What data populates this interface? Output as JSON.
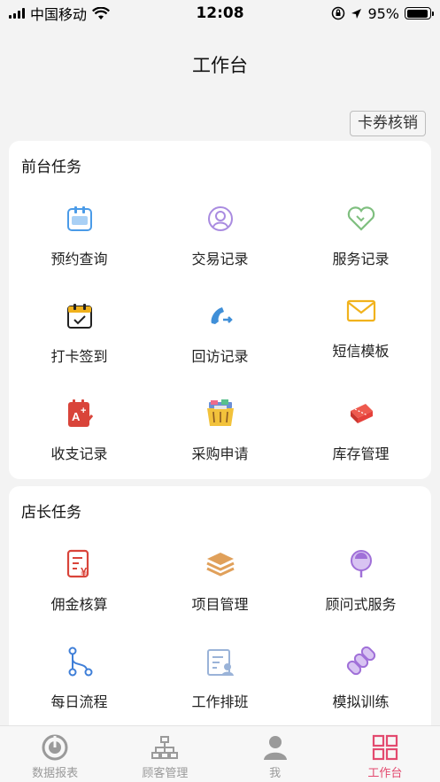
{
  "status": {
    "carrier": "中国移动",
    "time": "12:08",
    "battery": "95%",
    "battery_level": 0.95
  },
  "header": {
    "title": "工作台"
  },
  "coupon_button": {
    "label": "卡券核销"
  },
  "sections": [
    {
      "title": "前台任务",
      "items": [
        {
          "label": "预约查询",
          "icon": "calendar-icon",
          "color": "#4a9be8"
        },
        {
          "label": "交易记录",
          "icon": "user-support-icon",
          "color": "#a98be0"
        },
        {
          "label": "服务记录",
          "icon": "heart-icon",
          "color": "#7fbf7f"
        },
        {
          "label": "打卡签到",
          "icon": "checkin-icon",
          "color": "#f1b21c"
        },
        {
          "label": "回访记录",
          "icon": "phone-callback-icon",
          "color": "#3f8fd8"
        },
        {
          "label": "短信模板",
          "icon": "envelope-icon",
          "color": "#f1b21c"
        },
        {
          "label": "收支记录",
          "icon": "ledger-icon",
          "color": "#d9443a"
        },
        {
          "label": "采购申请",
          "icon": "shopping-basket-icon",
          "color": "#f2c23b"
        },
        {
          "label": "库存管理",
          "icon": "inventory-box-icon",
          "color": "#e5413b"
        }
      ]
    },
    {
      "title": "店长任务",
      "items": [
        {
          "label": "佣金核算",
          "icon": "commission-document-icon",
          "color": "#d9443a"
        },
        {
          "label": "项目管理",
          "icon": "layers-icon",
          "color": "#e0a05a"
        },
        {
          "label": "顾问式服务",
          "icon": "consultant-pin-icon",
          "color": "#a070d8"
        },
        {
          "label": "每日流程",
          "icon": "flow-icon",
          "color": "#3f7fd8"
        },
        {
          "label": "工作排班",
          "icon": "schedule-icon",
          "color": "#9ab3d8"
        },
        {
          "label": "模拟训练",
          "icon": "training-icon",
          "color": "#a070d8"
        }
      ]
    }
  ],
  "tabs": [
    {
      "label": "数据报表",
      "icon": "report-icon",
      "active": false
    },
    {
      "label": "顾客管理",
      "icon": "org-chart-icon",
      "active": false
    },
    {
      "label": "我",
      "icon": "person-icon",
      "active": false
    },
    {
      "label": "工作台",
      "icon": "grid-icon",
      "active": true
    }
  ],
  "colors": {
    "accent": "#e34a6f",
    "inactive": "#9a9a9a"
  }
}
